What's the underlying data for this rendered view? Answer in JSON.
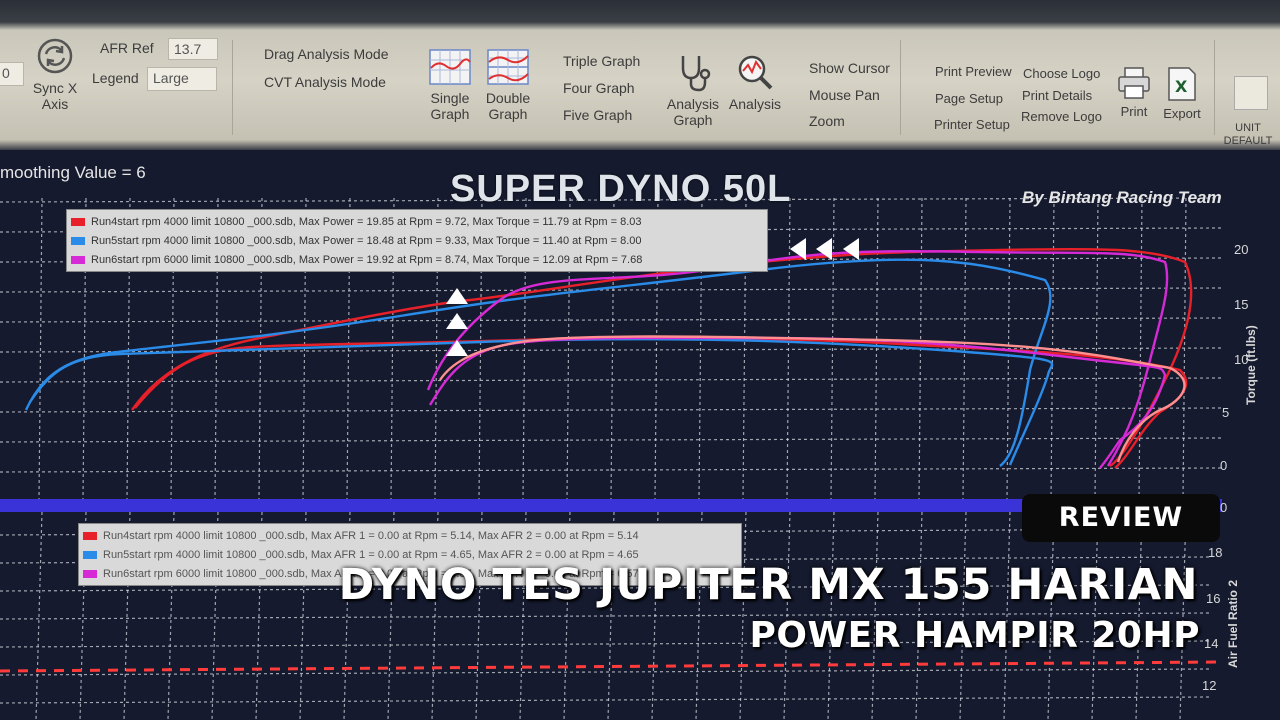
{
  "ribbon": {
    "left_field_value": "0",
    "sync": {
      "label": "Sync X Axis"
    },
    "afr_ref": {
      "label": "AFR Ref",
      "value": "13.7"
    },
    "legend": {
      "label": "Legend",
      "value": "Large"
    },
    "modes": [
      "Drag Analysis Mode",
      "CVT Analysis Mode"
    ],
    "graph_buttons": [
      {
        "label": "Single Graph",
        "icon": "single-graph-icon"
      },
      {
        "label": "Double Graph",
        "icon": "double-graph-icon"
      }
    ],
    "multi_graph": [
      "Triple Graph",
      "Four Graph",
      "Five Graph"
    ],
    "analysis_buttons": [
      {
        "label": "Analysis Graph",
        "icon": "stethoscope-icon"
      },
      {
        "label": "Analysis",
        "icon": "magnifier-chart-icon"
      }
    ],
    "view_items": [
      "Show Cursor",
      "Mouse Pan",
      "Zoom"
    ],
    "print_items": [
      "Print Preview",
      "Page Setup",
      "Printer Setup"
    ],
    "logo_items": [
      "Choose Logo",
      "Print Details",
      "Remove Logo"
    ],
    "print_button": {
      "label": "Print",
      "icon": "printer-icon"
    },
    "export_button": {
      "label": "Export",
      "icon": "excel-icon"
    },
    "unit_default": {
      "label": "UNIT DEFAULT"
    }
  },
  "screen": {
    "smoothing": "moothing Value = 6",
    "title": "SUPER DYNO 50L",
    "byline": "By Bintang Racing Team",
    "top_legend": [
      {
        "text": "Run4start  rpm 4000  limit 10800  _000.sdb, Max Power = 19.85 at Rpm = 9.72, Max Torque = 11.79 at Rpm = 8.03",
        "color": "#e8202a"
      },
      {
        "text": "Run5start  rpm 4000  limit 10800  _000.sdb, Max Power = 18.48 at Rpm = 9.33, Max Torque = 11.40 at Rpm = 8.00",
        "color": "#2a8be8"
      },
      {
        "text": "Run6start  rpm 6000  limit 10800  _000.sdb, Max Power = 19.92 at Rpm = 8.74, Max Torque = 12.09 at Rpm = 7.68",
        "color": "#d62ad6"
      }
    ],
    "bottom_legend": [
      {
        "text": "Run4start  rpm 4000  limit 10800  _000.sdb, Max AFR 1 = 0.00 at Rpm = 5.14, Max AFR 2 = 0.00 at Rpm = 5.14",
        "color": "#e8202a"
      },
      {
        "text": "Run5start  rpm 4000  limit 10800  _000.sdb, Max AFR 1 = 0.00 at Rpm = 4.65, Max AFR 2 = 0.00 at Rpm = 4.65",
        "color": "#2a8be8"
      },
      {
        "text": "Run6start  rpm 6000  limit 10800  _000.sdb, Max AFR 1 = 0.00 at Rpm = 6.57, Max AFR 2 = 0.00 at Rpm = 6.57",
        "color": "#d62ad6"
      }
    ],
    "top_ylabel": "Torque (ft.lbs)",
    "bottom_ylabel": "Air Fuel Ratio 2",
    "top_yticks": [
      "20",
      "15",
      "10",
      "5",
      "0"
    ],
    "bottom_yticks": [
      "0",
      "18",
      "16",
      "14",
      "12"
    ]
  },
  "overlay": {
    "badge": "REVIEW",
    "headline_1": "DYNO TES JUPITER MX 155 HARIAN",
    "headline_2": "POWER HAMPIR 20HP"
  },
  "colors": {
    "run4": "#e8202a",
    "run5": "#2a8be8",
    "run6": "#d62ad6",
    "grid": "#d0d4dc",
    "afr_ref": "#ff3b3b",
    "divider": "#3a34d8"
  }
}
